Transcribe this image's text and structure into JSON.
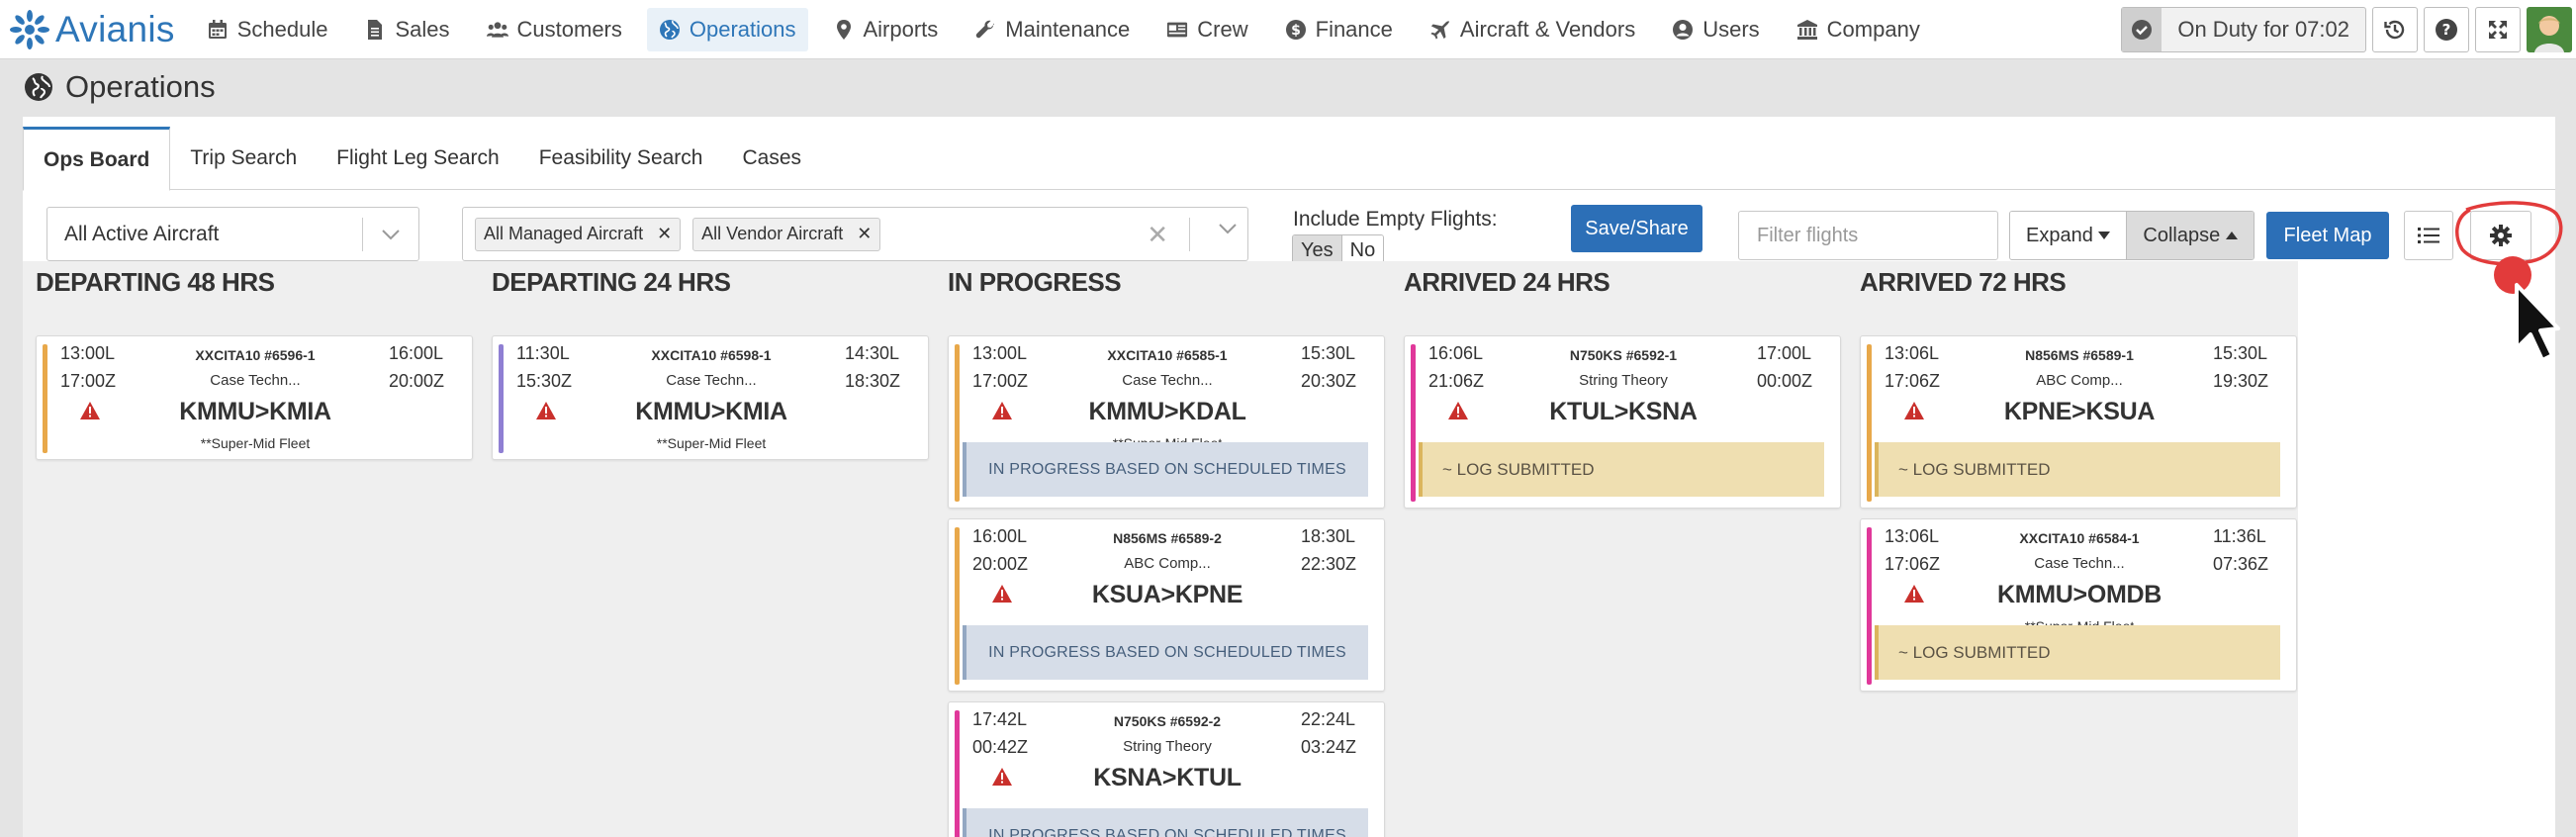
{
  "brand": {
    "name": "Avianis"
  },
  "nav": [
    {
      "label": "Schedule",
      "icon": "calendar-icon"
    },
    {
      "label": "Sales",
      "icon": "document-icon"
    },
    {
      "label": "Customers",
      "icon": "users-icon"
    },
    {
      "label": "Operations",
      "icon": "globe-icon",
      "active": true
    },
    {
      "label": "Airports",
      "icon": "map-marker-icon"
    },
    {
      "label": "Maintenance",
      "icon": "wrench-icon"
    },
    {
      "label": "Crew",
      "icon": "id-card-icon"
    },
    {
      "label": "Finance",
      "icon": "dollar-icon"
    },
    {
      "label": "Aircraft & Vendors",
      "icon": "plane-icon"
    },
    {
      "label": "Users",
      "icon": "user-icon"
    },
    {
      "label": "Company",
      "icon": "bank-icon"
    }
  ],
  "header": {
    "duty": "On Duty for 07:02"
  },
  "page": {
    "title": "Operations"
  },
  "tabs": [
    "Ops Board",
    "Trip Search",
    "Flight Leg Search",
    "Feasibility Search",
    "Cases"
  ],
  "filters": {
    "aircraft_select": "All Active Aircraft",
    "chips": [
      "All Managed Aircraft",
      "All Vendor Aircraft"
    ],
    "include_empty_label": "Include Empty Flights:",
    "yes": "Yes",
    "no": "No",
    "save_share": "Save/Share",
    "filter_placeholder": "Filter flights",
    "expand": "Expand",
    "collapse": "Collapse",
    "fleet_map": "Fleet Map"
  },
  "columns": [
    {
      "title": "DEPARTING 48 HRS",
      "cards": [
        {
          "dep_local": "13:00L",
          "dep_z": "17:00Z",
          "arr_local": "16:00L",
          "arr_z": "20:00Z",
          "tail": "XXCITA10 #6596-1",
          "customer": "Case Techn...",
          "route": "KMMU>KMIA",
          "fleet": "**Super-Mid Fleet",
          "status": "",
          "color": "#e8a84a"
        }
      ]
    },
    {
      "title": "DEPARTING 24 HRS",
      "cards": [
        {
          "dep_local": "11:30L",
          "dep_z": "15:30Z",
          "arr_local": "14:30L",
          "arr_z": "18:30Z",
          "tail": "XXCITA10 #6598-1",
          "customer": "Case Techn...",
          "route": "KMMU>KMIA",
          "fleet": "**Super-Mid Fleet",
          "status": "",
          "color": "#8f7fd3"
        }
      ]
    },
    {
      "title": "IN PROGRESS",
      "cards": [
        {
          "dep_local": "13:00L",
          "dep_z": "17:00Z",
          "arr_local": "15:30L",
          "arr_z": "20:30Z",
          "tail": "XXCITA10 #6585-1",
          "customer": "Case Techn...",
          "route": "KMMU>KDAL",
          "fleet": "**Super-Mid Fleet",
          "status": "IN PROGRESS BASED ON SCHEDULED TIMES",
          "color": "#e8a84a"
        },
        {
          "dep_local": "16:00L",
          "dep_z": "20:00Z",
          "arr_local": "18:30L",
          "arr_z": "22:30Z",
          "tail": "N856MS #6589-2",
          "customer": "ABC Comp...",
          "route": "KSUA>KPNE",
          "fleet": "",
          "status": "IN PROGRESS BASED ON SCHEDULED TIMES",
          "color": "#e8a84a"
        },
        {
          "dep_local": "17:42L",
          "dep_z": "00:42Z",
          "arr_local": "22:24L",
          "arr_z": "03:24Z",
          "tail": "N750KS #6592-2",
          "customer": "String Theory",
          "route": "KSNA>KTUL",
          "fleet": "",
          "status": "IN PROGRESS BASED ON SCHEDULED TIMES",
          "color": "#e0389a"
        }
      ]
    },
    {
      "title": "ARRIVED 24 HRS",
      "cards": [
        {
          "dep_local": "16:06L",
          "dep_z": "21:06Z",
          "arr_local": "17:00L",
          "arr_z": "00:00Z",
          "tail": "N750KS #6592-1",
          "customer": "String Theory",
          "route": "KTUL>KSNA",
          "fleet": "",
          "status": "~ LOG SUBMITTED",
          "color": "#e0389a"
        }
      ]
    },
    {
      "title": "ARRIVED 72 HRS",
      "cards": [
        {
          "dep_local": "13:06L",
          "dep_z": "17:06Z",
          "arr_local": "15:30L",
          "arr_z": "19:30Z",
          "tail": "N856MS #6589-1",
          "customer": "ABC Comp...",
          "route": "KPNE>KSUA",
          "fleet": "",
          "status": "~ LOG SUBMITTED",
          "color": "#e8a84a"
        },
        {
          "dep_local": "13:06L",
          "dep_z": "17:06Z",
          "arr_local": "11:36L",
          "arr_z": "07:36Z",
          "tail": "XXCITA10 #6584-1",
          "customer": "Case Techn...",
          "route": "KMMU>OMDB",
          "fleet": "**Super-Mid Fleet",
          "status": "~ LOG SUBMITTED",
          "color": "#e0389a"
        }
      ]
    }
  ]
}
